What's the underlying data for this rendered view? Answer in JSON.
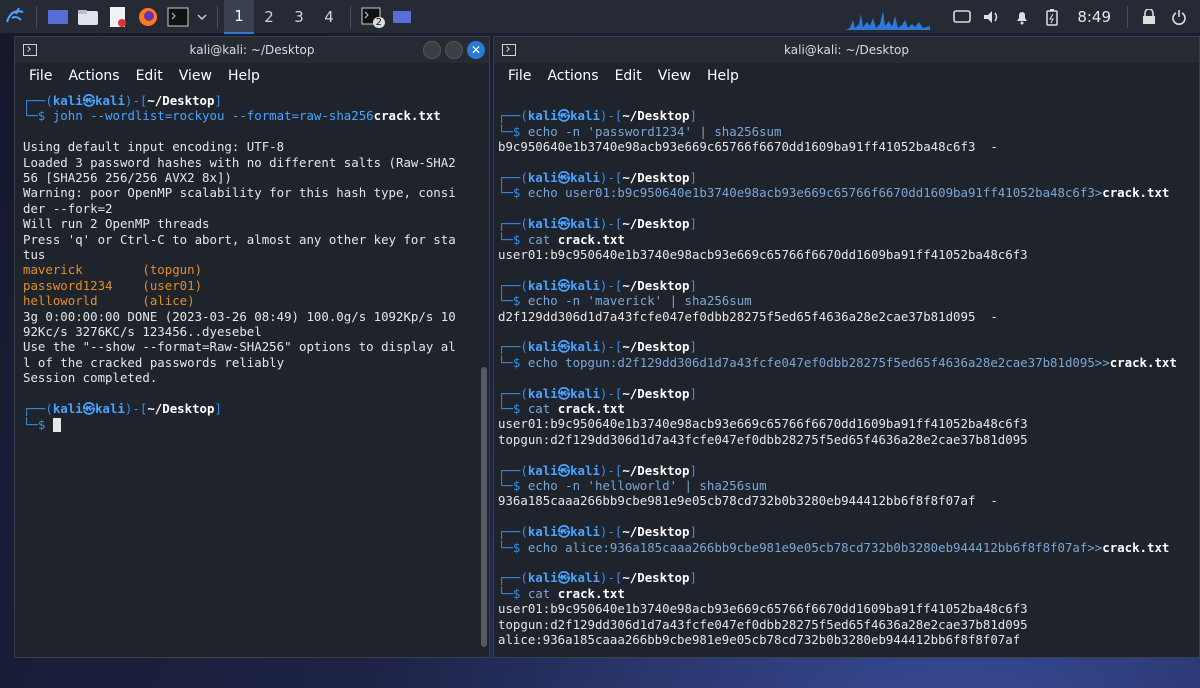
{
  "panel": {
    "workspaces": [
      "1",
      "2",
      "3",
      "4"
    ],
    "active_workspace": "1",
    "taskbar_badge": "2",
    "clock": "8:49"
  },
  "left_window": {
    "title": "kali@kali: ~/Desktop",
    "menu": [
      "File",
      "Actions",
      "Edit",
      "View",
      "Help"
    ],
    "prompt": {
      "user": "kali",
      "at": "㉿",
      "host": "kali",
      "dir": "~/Desktop"
    },
    "command": {
      "prog": "john --wordlist=rockyou --format=raw-sha256",
      "file": "crack.txt"
    },
    "output": [
      "Using default input encoding: UTF-8",
      "Loaded 3 password hashes with no different salts (Raw-SHA2",
      "56 [SHA256 256/256 AVX2 8x])",
      "Warning: poor OpenMP scalability for this hash type, consi",
      "der --fork=2",
      "Will run 2 OpenMP threads",
      "Press 'q' or Ctrl-C to abort, almost any other key for sta",
      "tus"
    ],
    "cracked": [
      {
        "pw": "maverick        ",
        "user": "(topgun)"
      },
      {
        "pw": "password1234    ",
        "user": "(user01)"
      },
      {
        "pw": "helloworld      ",
        "user": "(alice)"
      }
    ],
    "output2": [
      "3g 0:00:00:00 DONE (2023-03-26 08:49) 100.0g/s 1092Kp/s 10",
      "92Kc/s 3276KC/s 123456..dyesebel",
      "Use the \"--show --format=Raw-SHA256\" options to display al",
      "l of the cracked passwords reliably",
      "Session completed."
    ]
  },
  "right_window": {
    "title": "kali@kali: ~/Desktop",
    "menu": [
      "File",
      "Actions",
      "Edit",
      "View",
      "Help"
    ],
    "blocks": [
      {
        "cmd": "echo -n 'password1234' | sha256sum",
        "file": "",
        "out": [
          "b9c950640e1b3740e98acb93e669c65766f6670dd1609ba91ff41052ba48c6f3  -"
        ]
      },
      {
        "cmd": "echo user01:b9c950640e1b3740e98acb93e669c65766f6670dd1609ba91ff41052ba48c6f3>",
        "file": "crack.txt",
        "out": []
      },
      {
        "cmd": "cat ",
        "file": "crack.txt",
        "out": [
          "user01:b9c950640e1b3740e98acb93e669c65766f6670dd1609ba91ff41052ba48c6f3"
        ]
      },
      {
        "cmd": "echo -n 'maverick' | sha256sum",
        "file": "",
        "out": [
          "d2f129dd306d1d7a43fcfe047ef0dbb28275f5ed65f4636a28e2cae37b81d095  -"
        ]
      },
      {
        "cmd": "echo topgun:d2f129dd306d1d7a43fcfe047ef0dbb28275f5ed65f4636a28e2cae37b81d095>>",
        "file": "crack.txt",
        "out": []
      },
      {
        "cmd": "cat ",
        "file": "crack.txt",
        "out": [
          "user01:b9c950640e1b3740e98acb93e669c65766f6670dd1609ba91ff41052ba48c6f3",
          "topgun:d2f129dd306d1d7a43fcfe047ef0dbb28275f5ed65f4636a28e2cae37b81d095"
        ]
      },
      {
        "cmd": "echo -n 'helloworld' | sha256sum",
        "file": "",
        "out": [
          "936a185caaa266bb9cbe981e9e05cb78cd732b0b3280eb944412bb6f8f8f07af  -"
        ]
      },
      {
        "cmd": "echo alice:936a185caaa266bb9cbe981e9e05cb78cd732b0b3280eb944412bb6f8f8f07af>>",
        "file": "crack.txt",
        "out": []
      },
      {
        "cmd": "cat ",
        "file": "crack.txt",
        "out": [
          "user01:b9c950640e1b3740e98acb93e669c65766f6670dd1609ba91ff41052ba48c6f3",
          "topgun:d2f129dd306d1d7a43fcfe047ef0dbb28275f5ed65f4636a28e2cae37b81d095",
          "alice:936a185caaa266bb9cbe981e9e05cb78cd732b0b3280eb944412bb6f8f8f07af"
        ]
      }
    ]
  }
}
